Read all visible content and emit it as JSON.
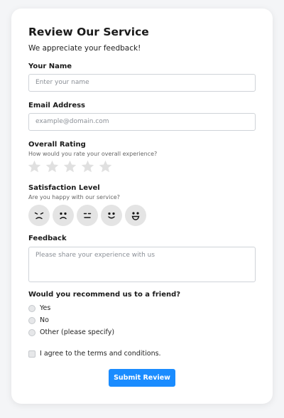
{
  "form": {
    "title": "Review Our Service",
    "subtitle": "We appreciate your feedback!"
  },
  "name_field": {
    "label": "Your Name",
    "placeholder": "Enter your name"
  },
  "email_field": {
    "label": "Email Address",
    "placeholder": "example@domain.com"
  },
  "rating": {
    "label": "Overall Rating",
    "hint": "How would you rate your overall experience?",
    "max_stars": 5,
    "selected": 0,
    "star_color": "#e0e0e0"
  },
  "satisfaction": {
    "label": "Satisfaction Level",
    "hint": "Are you happy with our service?",
    "options": [
      "very-unhappy-icon",
      "unhappy-icon",
      "neutral-icon",
      "happy-icon",
      "very-happy-icon"
    ],
    "selected": null
  },
  "feedback": {
    "label": "Feedback",
    "placeholder": "Please share your experience with us"
  },
  "recommend": {
    "label": "Would you recommend us to a friend?",
    "options": [
      "Yes",
      "No",
      "Other (please specify)"
    ],
    "selected": null
  },
  "terms": {
    "label": "I agree to the terms and conditions.",
    "checked": false
  },
  "submit": {
    "label": "Submit Review",
    "color": "#1a8cff"
  }
}
